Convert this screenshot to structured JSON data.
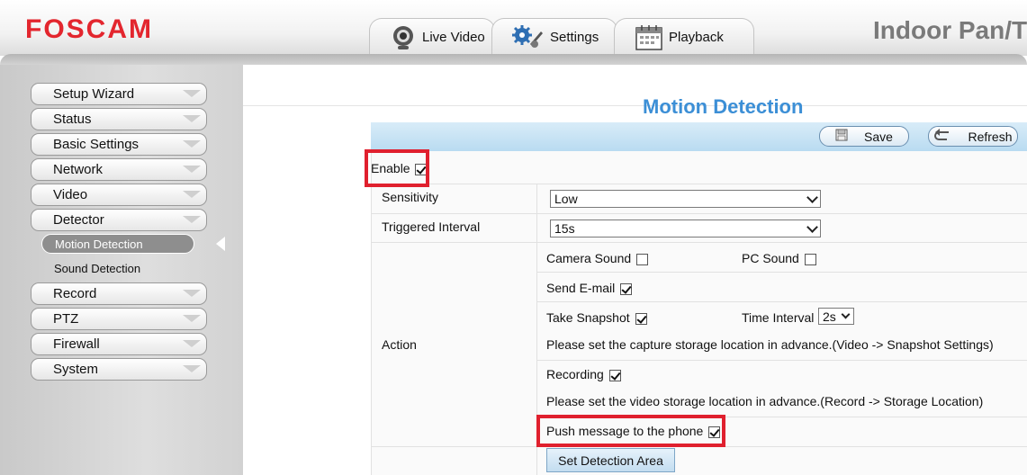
{
  "header": {
    "logo": "FOSCAM",
    "product_title": "Indoor Pan/T",
    "tabs": [
      {
        "label": "Live Video",
        "icon": "webcam-icon"
      },
      {
        "label": "Settings",
        "icon": "gears-icon"
      },
      {
        "label": "Playback",
        "icon": "calendar-icon"
      }
    ]
  },
  "sidebar": {
    "items": [
      {
        "label": "Setup Wizard"
      },
      {
        "label": "Status"
      },
      {
        "label": "Basic Settings"
      },
      {
        "label": "Network"
      },
      {
        "label": "Video"
      },
      {
        "label": "Detector"
      }
    ],
    "sub_items": [
      {
        "label": "Motion Detection",
        "active": true
      },
      {
        "label": "Sound Detection",
        "active": false
      }
    ],
    "items_after": [
      {
        "label": "Record"
      },
      {
        "label": "PTZ"
      },
      {
        "label": "Firewall"
      },
      {
        "label": "System"
      }
    ]
  },
  "main": {
    "title": "Motion Detection",
    "toolbar": {
      "save_label": "Save",
      "refresh_label": "Refresh"
    },
    "enable_label": "Enable",
    "enable_checked": true,
    "sensitivity": {
      "label": "Sensitivity",
      "value": "Low"
    },
    "triggered_interval": {
      "label": "Triggered Interval",
      "value": "15s"
    },
    "action": {
      "label": "Action",
      "camera_sound_label": "Camera Sound",
      "camera_sound_checked": false,
      "pc_sound_label": "PC Sound",
      "pc_sound_checked": false,
      "send_email_label": "Send E-mail",
      "send_email_checked": true,
      "take_snapshot_label": "Take Snapshot",
      "take_snapshot_checked": true,
      "time_interval_label": "Time Interval",
      "time_interval_value": "2s",
      "snapshot_note": "Please set the capture storage location in advance.(Video -> Snapshot Settings)",
      "recording_label": "Recording",
      "recording_checked": true,
      "recording_note": "Please set the video storage location in advance.(Record -> Storage Location)",
      "push_message_label": "Push message to the phone",
      "push_message_checked": true
    },
    "set_detection_area_label": "Set Detection Area"
  },
  "colors": {
    "brand_red": "#e3262e",
    "title_blue": "#3c8fd6",
    "highlight_red": "#e0202e"
  }
}
